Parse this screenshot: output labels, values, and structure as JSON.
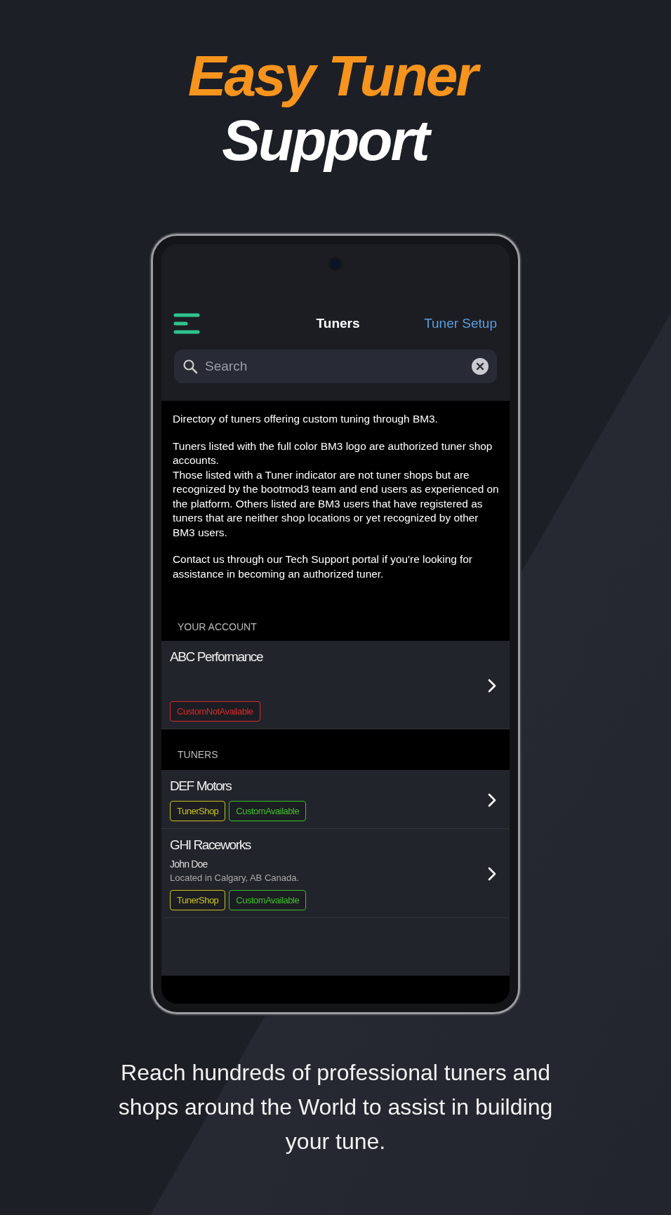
{
  "headline": {
    "line_1": "Easy Tuner",
    "line_2": "Support"
  },
  "app": {
    "title": "Tuners",
    "action": "Tuner Setup",
    "search": {
      "placeholder": "Search"
    },
    "intro": [
      [
        "Directory of tuners offering custom tuning through BM3."
      ],
      [
        "Tuners listed with the full color BM3 logo are authorized tuner shop accounts.",
        "Those listed with a Tuner indicator are not tuner shops but are recognized by the bootmod3 team and end users as experienced on the platform. Others listed are BM3 users that have registered as tuners that are neither shop locations or yet recognized by other BM3 users."
      ],
      [
        "Contact us through our Tech Support portal if you're looking for assistance in becoming an authorized tuner."
      ]
    ],
    "sections": [
      {
        "header": "YOUR ACCOUNT",
        "items": [
          {
            "name": "ABC Performance",
            "tags": [
              {
                "label": "CustomNotAvailable",
                "color": "#d42a2a"
              }
            ]
          }
        ]
      },
      {
        "header": "TUNERS",
        "items": [
          {
            "name": "DEF Motors",
            "tags": [
              {
                "label": "TunerShop",
                "color": "#c9c21e"
              },
              {
                "label": "CustomAvailable",
                "color": "#3fbf2a"
              }
            ]
          },
          {
            "name": "GHI Raceworks",
            "contact": "John Doe",
            "location": "Located in Calgary, AB Canada.",
            "tags": [
              {
                "label": "TunerShop",
                "color": "#c9c21e"
              },
              {
                "label": "CustomAvailable",
                "color": "#3fbf2a"
              }
            ]
          }
        ]
      }
    ]
  },
  "caption": "Reach hundreds of professional tuners and shops around the World to assist in building your tune."
}
